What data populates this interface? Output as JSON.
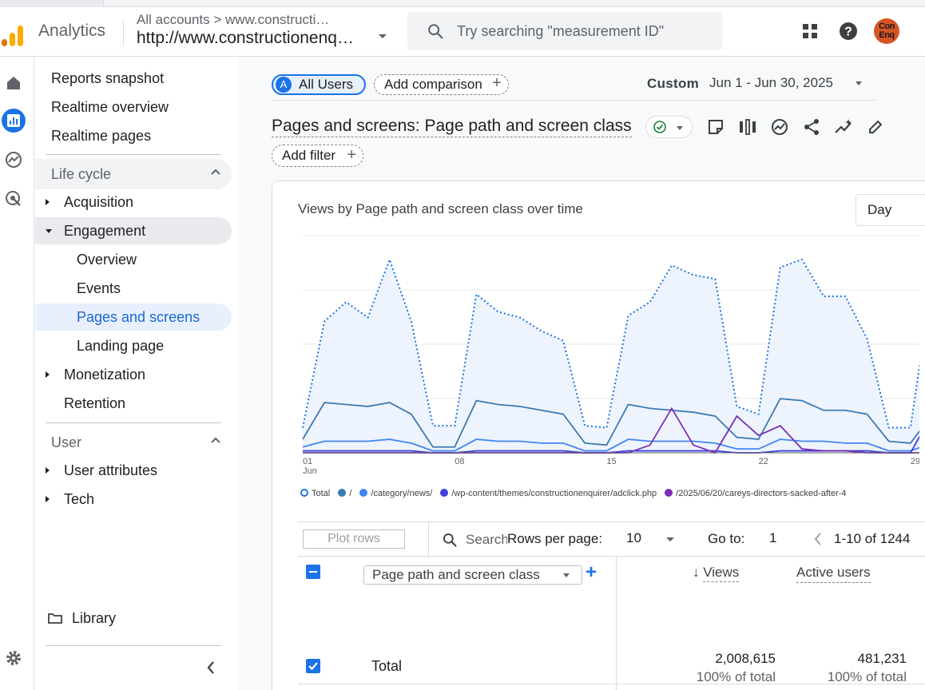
{
  "header": {
    "app_name": "Analytics",
    "account_breadcrumb": "All accounts > www.constructi…",
    "property_name": "http://www.constructionenq…",
    "search_placeholder": "Try searching \"measurement ID\"",
    "avatar_text": "Con Enq",
    "brand_colors": {
      "logo_orange": "#f9ab00",
      "logo_dark_orange": "#e37400",
      "avatar_bg": "#d65424"
    }
  },
  "nav_rail": {
    "items": [
      "home-icon",
      "reports-icon",
      "explore-icon",
      "advertising-icon",
      "settings-icon"
    ],
    "active": "reports-icon"
  },
  "sidebar": {
    "top_items": [
      "Reports snapshot",
      "Realtime overview",
      "Realtime pages"
    ],
    "lifecycle": {
      "label": "Life cycle",
      "items": [
        {
          "label": "Acquisition"
        },
        {
          "label": "Engagement"
        },
        {
          "label": "Overview"
        },
        {
          "label": "Events"
        },
        {
          "label": "Pages and screens"
        },
        {
          "label": "Landing page"
        },
        {
          "label": "Monetization"
        },
        {
          "label": "Retention"
        }
      ]
    },
    "user": {
      "label": "User",
      "items": [
        {
          "label": "User attributes"
        },
        {
          "label": "Tech"
        }
      ]
    },
    "library": "Library"
  },
  "toolbar": {
    "segment_letter": "A",
    "segment": "All Users",
    "add_comparison": "Add comparison",
    "date_label": "Custom",
    "date_range": "Jun 1 - Jun 30, 2025",
    "report_title": "Pages and screens: Page path and screen class",
    "add_filter": "Add filter",
    "tool_icons": [
      "notes-icon",
      "compare-columns-icon",
      "insights-icon",
      "share-icon",
      "trend-icon",
      "edit-icon"
    ]
  },
  "chart_card": {
    "title": "Views by Page path and screen class over time",
    "granularity": "Day",
    "x_tick_labels": [
      "01",
      "08",
      "15",
      "22",
      "29"
    ],
    "x_sub_label": "Jun",
    "legend": [
      {
        "label": "Total",
        "color": "#1a73e8",
        "hollow": true
      },
      {
        "label": "/",
        "color": "#3c7ab1"
      },
      {
        "label": "/category/news/",
        "color": "#4285f4"
      },
      {
        "label": "/wp-content/themes/constructionenquirer/adclick.php",
        "color": "#3f3fd9"
      },
      {
        "label": "/2025/06/20/careys-directors-sacked-after-4",
        "color": "#7b2fb5"
      }
    ]
  },
  "chart_data": {
    "type": "line",
    "x": [
      1,
      2,
      3,
      4,
      5,
      6,
      7,
      8,
      9,
      10,
      11,
      12,
      13,
      14,
      15,
      16,
      17,
      18,
      19,
      20,
      21,
      22,
      23,
      24,
      25,
      26,
      27,
      28,
      29,
      30
    ],
    "series": [
      {
        "name": "Total",
        "style": "dotted-area",
        "color": "#1a73e8",
        "values": [
          0.13,
          0.68,
          0.78,
          0.7,
          1.0,
          0.68,
          0.14,
          0.14,
          0.82,
          0.73,
          0.7,
          0.63,
          0.58,
          0.14,
          0.13,
          0.71,
          0.78,
          0.97,
          0.92,
          0.9,
          0.24,
          0.2,
          0.96,
          1.0,
          0.81,
          0.81,
          0.59,
          0.13,
          0.13,
          0.9
        ]
      },
      {
        "name": "/",
        "color": "#3c7ab1",
        "values": [
          0.07,
          0.26,
          0.25,
          0.24,
          0.26,
          0.2,
          0.03,
          0.03,
          0.27,
          0.25,
          0.24,
          0.22,
          0.2,
          0.05,
          0.04,
          0.25,
          0.23,
          0.22,
          0.21,
          0.19,
          0.08,
          0.07,
          0.28,
          0.27,
          0.22,
          0.22,
          0.2,
          0.06,
          0.05,
          0.2
        ]
      },
      {
        "name": "/category/news/",
        "color": "#4285f4",
        "values": [
          0.03,
          0.06,
          0.06,
          0.06,
          0.07,
          0.05,
          0.01,
          0.01,
          0.07,
          0.06,
          0.06,
          0.05,
          0.05,
          0.01,
          0.01,
          0.07,
          0.06,
          0.06,
          0.06,
          0.05,
          0.02,
          0.02,
          0.07,
          0.06,
          0.06,
          0.05,
          0.05,
          0.01,
          0.01,
          0.05
        ]
      },
      {
        "name": "/wp-content/themes/constructionenquirer/adclick.php",
        "color": "#3f3fd9",
        "values": [
          0.01,
          0.01,
          0.01,
          0.01,
          0.01,
          0.01,
          0.0,
          0.0,
          0.01,
          0.01,
          0.01,
          0.01,
          0.01,
          0.0,
          0.0,
          0.01,
          0.01,
          0.01,
          0.01,
          0.01,
          0.0,
          0.0,
          0.01,
          0.01,
          0.01,
          0.01,
          0.01,
          0.0,
          0.0,
          0.2
        ]
      },
      {
        "name": "/2025/06/20/careys-directors-sacked-after-4",
        "color": "#7b2fb5",
        "values": [
          0,
          0,
          0,
          0,
          0,
          0,
          0,
          0,
          0,
          0,
          0,
          0,
          0,
          0,
          0,
          0,
          0.04,
          0.23,
          0.04,
          0.0,
          0.19,
          0.09,
          0.14,
          0.02,
          0.01,
          0.01,
          0.0,
          0.0,
          0.0,
          0.0
        ]
      }
    ],
    "xlabel": "",
    "ylabel": "",
    "grid": true
  },
  "table": {
    "plot_rows": "Plot rows",
    "search_placeholder": "Search…",
    "rows_per_page_label": "Rows per page:",
    "rows_per_page": "10",
    "goto_label": "Go to:",
    "goto_value": "1",
    "page_range": "1-10 of 1244",
    "dimension": "Page path and screen class",
    "columns": [
      "Views",
      "Active users"
    ],
    "sort_indicator": "↓",
    "total_row": {
      "label": "Total",
      "views": "2,008,615",
      "views_pct": "100% of total",
      "active_users": "481,231",
      "active_users_pct": "100% of total",
      "cut_off": "A"
    }
  }
}
